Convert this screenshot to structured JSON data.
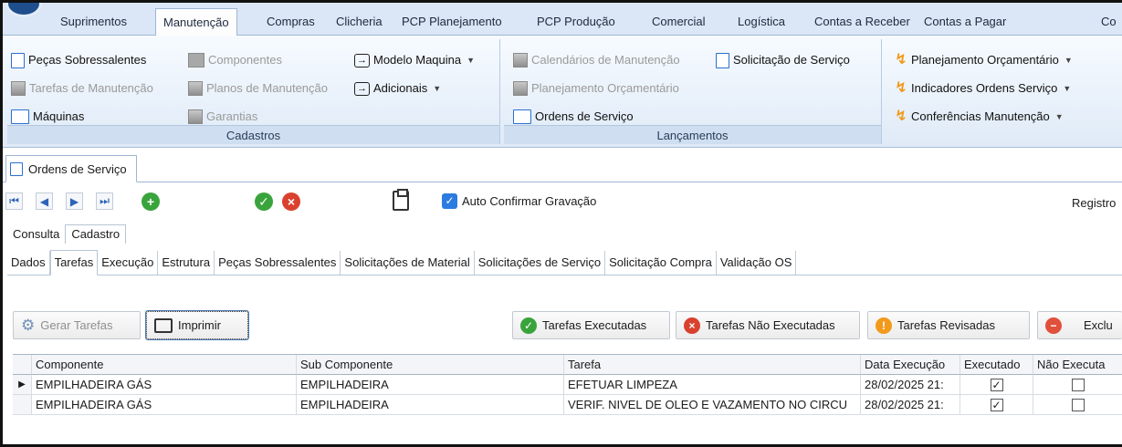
{
  "ribbon": {
    "tabs": [
      "Suprimentos",
      "Manutenção",
      "Compras",
      "Clicheria",
      "PCP Planejamento",
      "PCP Produção",
      "Comercial",
      "Logística",
      "Contas a Receber",
      "Contas a Pagar",
      "Co"
    ],
    "active_tab": "Manutenção",
    "groups": {
      "cadastros": {
        "label": "Cadastros",
        "items": [
          "Peças Sobressalentes",
          "Componentes",
          "Modelo Maquina",
          "Tarefas de Manutenção",
          "Planos de Manutenção",
          "Adicionais",
          "Máquinas",
          "Garantias"
        ]
      },
      "lancamentos": {
        "label": "Lançamentos",
        "items": [
          "Calendários de Manutenção",
          "Solicitação de Serviço",
          "Planejamento Orçamentário",
          "Ordens de Serviço"
        ]
      },
      "relatorios": {
        "items": [
          "Planejamento Orçamentário",
          "Indicadores Ordens Serviço",
          "Conferências Manutenção"
        ]
      }
    }
  },
  "document_tab": "Ordens de Serviço",
  "toolbar": {
    "auto_confirm_label": "Auto Confirmar Gravação",
    "auto_confirm_checked": true,
    "registro_label": "Registro"
  },
  "view_tabs": [
    "Consulta",
    "Cadastro"
  ],
  "section_tabs": [
    "Dados",
    "Tarefas",
    "Execução",
    "Estrutura",
    "Peças Sobressalentes",
    "Solicitações de Material",
    "Solicitações de Serviço",
    "Solicitação Compra",
    "Validação OS"
  ],
  "actions": {
    "gerar_tarefas": "Gerar Tarefas",
    "imprimir": "Imprimir",
    "executadas": "Tarefas Executadas",
    "nao_executadas": "Tarefas Não Executadas",
    "revisadas": "Tarefas Revisadas",
    "excluir": "Exclu"
  },
  "grid": {
    "columns": [
      "Componente",
      "Sub Componente",
      "Tarefa",
      "Data Execução",
      "Executado",
      "Não Executa"
    ],
    "rows": [
      {
        "componente": "EMPILHADEIRA GÁS",
        "sub_componente": "EMPILHADEIRA",
        "tarefa": "EFETUAR LIMPEZA",
        "data": "28/02/2025 21:",
        "executado": true,
        "nao_executado": false
      },
      {
        "componente": "EMPILHADEIRA GÁS",
        "sub_componente": "EMPILHADEIRA",
        "tarefa": "VERIF. NIVEL DE OLEO E VAZAMENTO NO CIRCU",
        "data": "28/02/2025 21:",
        "executado": true,
        "nao_executado": false
      }
    ]
  },
  "colors": {
    "ribbon_bg": "#dbe7f6",
    "accent_blue": "#2c7be0",
    "ok_green": "#3aa43c",
    "cancel_red": "#d9412f",
    "bolt_orange": "#f29a1b"
  }
}
